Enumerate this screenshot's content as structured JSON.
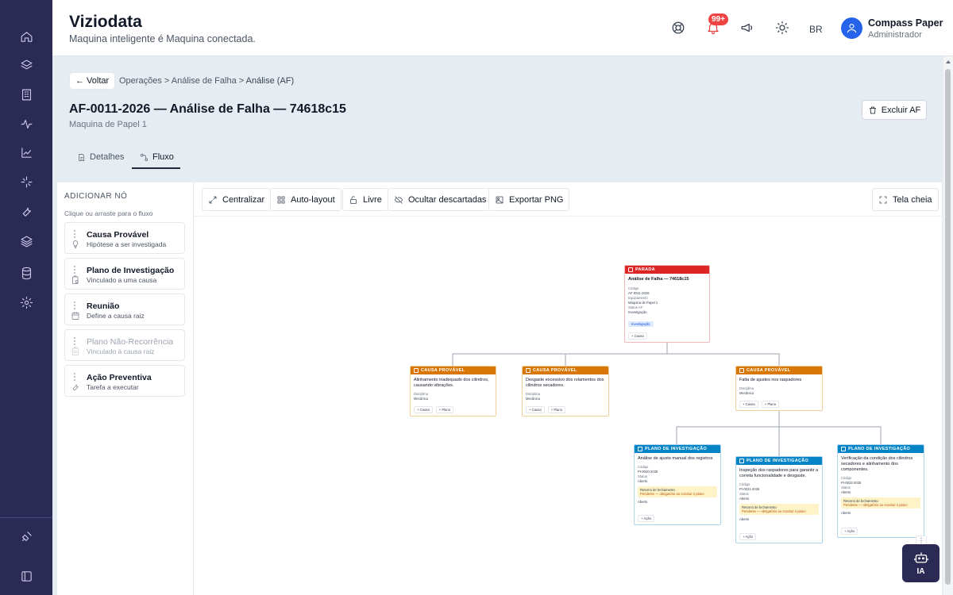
{
  "header": {
    "brand": "Viziodata",
    "tagline": "Maquina inteligente é Maquina conectada.",
    "notif_badge": "99+",
    "language": "BR",
    "user_name": "Compass Paper",
    "user_role": "Administrador"
  },
  "rail": {
    "icons": [
      "home-icon",
      "layers-icon",
      "building-icon",
      "activity-icon",
      "chart-icon",
      "sparkle-icon",
      "wrench-icon",
      "stack-icon",
      "database-icon",
      "settings-icon",
      "plug-icon",
      "sidebar-toggle-icon"
    ]
  },
  "page": {
    "back_label": "← Voltar",
    "breadcrumb": [
      "Operações",
      "Análise de Falha",
      "Análise (AF)"
    ],
    "title": "AF-0011-2026 — Análise de Falha — 74618c15",
    "subtitle": "Maquina de Papel 1",
    "delete_label": "Excluir AF",
    "tabs": [
      {
        "label": "Detalhes"
      },
      {
        "label": "Fluxo"
      }
    ]
  },
  "palette": {
    "heading": "ADICIONAR NÓ",
    "hint": "Clique ou arraste para o fluxo",
    "items": [
      {
        "title": "Causa Provável",
        "desc": "Hipótese a ser investigada"
      },
      {
        "title": "Plano de Investigação",
        "desc": "Vinculado a uma causa"
      },
      {
        "title": "Reunião",
        "desc": "Define a causa raiz"
      },
      {
        "title": "Plano Não-Recorrência",
        "desc": "Vinculado à causa raiz"
      },
      {
        "title": "Ação Preventiva",
        "desc": "Tarefa a executar"
      }
    ]
  },
  "toolbar": {
    "center": "Centralizar",
    "autolayout": "Auto-layout",
    "free": "Livre",
    "hide": "Ocultar descartadas",
    "export": "Exportar PNG",
    "fullscreen": "Tela cheia"
  },
  "flow": {
    "root": {
      "badge": "PARADA",
      "title": "Análise de Falha — 74618c15",
      "code_label": "Código",
      "code": "AF-0011-2026",
      "equip_label": "Equipamento",
      "equip": "Máquina de Papel 1",
      "status_label": "Status AF",
      "status": "Investigação",
      "chip": "Investigação",
      "action": "+ Causa"
    },
    "causes": [
      {
        "badge": "CAUSA PROVÁVEL",
        "title": "Alinhamento inadequado dos cilindros, causando vibrações.",
        "disc_label": "Disciplina",
        "disc": "Mecânica",
        "a1": "+ Causa",
        "a2": "+ Plano"
      },
      {
        "badge": "CAUSA PROVÁVEL",
        "title": "Desgaste excessivo dos rolamentos dos cilindros secadores.",
        "disc_label": "Disciplina",
        "disc": "Mecânica",
        "a1": "+ Causa",
        "a2": "+ Plano"
      },
      {
        "badge": "CAUSA PROVÁVEL",
        "title": "Falta de ajustes nos raspadores",
        "disc_label": "Disciplina",
        "disc": "Mecânica",
        "a1": "+ Causa",
        "a2": "+ Plano"
      }
    ],
    "plans": [
      {
        "badge": "PLANO DE INVESTIGAÇÃO",
        "title": "Análise de ajuste manual dos registros",
        "code_label": "Código",
        "code": "PI-0020-2026",
        "status_label": "Status",
        "status": "Aberto",
        "warn1": "Retorno de fechamento",
        "warn2": "Pendente — obrigatório ao concluir o plano",
        "chip": "Aberto",
        "action": "+ Ação"
      },
      {
        "badge": "PLANO DE INVESTIGAÇÃO",
        "title": "Inspeção dos raspadores para garantir a correta funcionalidade e desgaste.",
        "code_label": "Código",
        "code": "PI-0021-2026",
        "status_label": "Status",
        "status": "Aberto",
        "warn1": "Retorno de fechamento",
        "warn2": "Pendente — obrigatório ao concluir o plano",
        "chip": "Aberto",
        "action": "+ Ação"
      },
      {
        "badge": "PLANO DE INVESTIGAÇÃO",
        "title": "Verificação da condição dos cilindros secadores e alinhamento dos componentes.",
        "code_label": "Código",
        "code": "PI-0022-2026",
        "status_label": "Status",
        "status": "Aberto",
        "warn1": "Retorno de fechamento",
        "warn2": "Pendente — obrigatório ao concluir o plano",
        "chip": "Aberto",
        "action": "+ Ação"
      }
    ]
  },
  "ai_label": "IA",
  "colors": {
    "rail": "#2b2a55",
    "parada": "#dc2626",
    "causa": "#d97706",
    "plano": "#0284c7",
    "avatar": "#2563eb"
  }
}
